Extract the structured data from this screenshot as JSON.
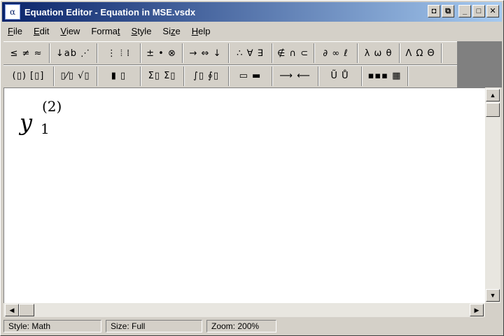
{
  "window": {
    "title": "Equation Editor - Equation in MSE.vsdx",
    "icon": "equation-editor-app-icon",
    "icon_glyph": "α",
    "controls": {
      "restore_app_glyph": "◘",
      "restore_doc_glyph": "⧉",
      "minimize_glyph": "_",
      "maximize_glyph": "□",
      "close_glyph": "✕"
    }
  },
  "menu": [
    {
      "label": "File",
      "ul": "F",
      "rest": "ile"
    },
    {
      "label": "Edit",
      "ul": "E",
      "rest": "dit"
    },
    {
      "label": "View",
      "ul": "V",
      "rest": "iew"
    },
    {
      "label": "Format",
      "pre": "Forma",
      "ul": "t",
      "rest": ""
    },
    {
      "label": "Style",
      "ul": "S",
      "rest": "tyle"
    },
    {
      "label": "Size",
      "pre": "Si",
      "ul": "z",
      "rest": "e"
    },
    {
      "label": "Help",
      "ul": "H",
      "rest": "elp"
    }
  ],
  "toolbar": {
    "row1": [
      "≤ ≠ ≈",
      "↓ab ⋰",
      "⋮ ⦙ ⁞",
      "± • ⊗",
      "→ ⇔ ↓",
      "∴ ∀ ∃",
      "∉ ∩ ⊂",
      "∂ ∞ ℓ",
      "λ ω θ",
      "Λ Ω Θ"
    ],
    "row2": [
      "(▯) [▯]",
      "▯⁄▯ √▯",
      "▮ ▯",
      "Σ▯ Σ▯",
      "∫▯ ∮▯",
      "▭ ▬",
      "⟶ ⟵",
      "Ũ Ů",
      "▪▪▪ ▦"
    ]
  },
  "equation": {
    "base": "y",
    "superscript": "(2)",
    "subscript": "1"
  },
  "scrollbars": {
    "up_glyph": "▲",
    "down_glyph": "▼",
    "left_glyph": "◀",
    "right_glyph": "▶"
  },
  "status": {
    "style": "Style: Math",
    "size": "Size: Full",
    "zoom": "Zoom: 200%"
  }
}
